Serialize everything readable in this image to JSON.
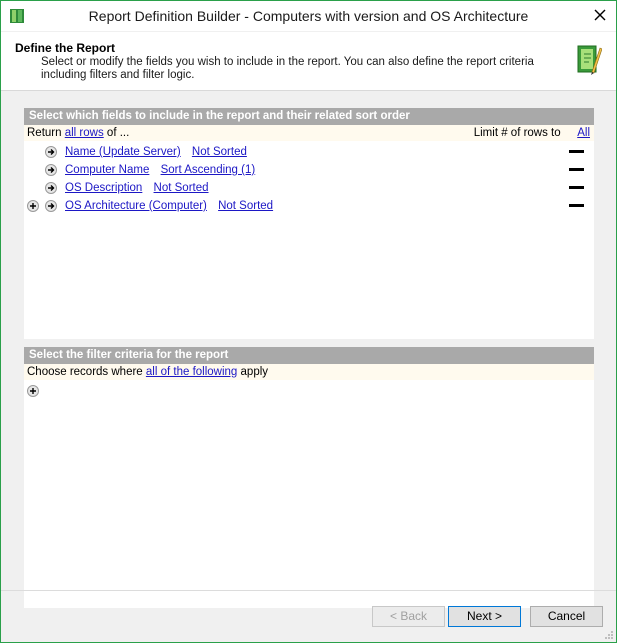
{
  "window": {
    "title": "Report Definition Builder - Computers with version and OS Architecture"
  },
  "header": {
    "title": "Define the Report",
    "description": "Select or modify the fields you wish to include in the report. You can also define the report criteria including filters and filter logic."
  },
  "fields_section": {
    "header": "Select which fields to include in the report and their related sort order",
    "return_prefix": "Return",
    "return_link": "all rows",
    "return_suffix": "of ...",
    "limit_label": "Limit # of rows to",
    "limit_link": "All",
    "rows": [
      {
        "field": "Name (Update Server)",
        "sort": "Not Sorted"
      },
      {
        "field": "Computer Name",
        "sort": "Sort Ascending (1)"
      },
      {
        "field": "OS Description",
        "sort": "Not Sorted"
      },
      {
        "field": "OS Architecture (Computer)",
        "sort": "Not Sorted"
      }
    ]
  },
  "filter_section": {
    "header": "Select the filter criteria for the report",
    "choose_prefix": "Choose records where",
    "choose_link": "all of the following",
    "choose_suffix": "apply"
  },
  "buttons": {
    "back": "< Back",
    "next": "Next >",
    "cancel": "Cancel"
  },
  "colors": {
    "window_border": "#2aa04a",
    "link": "#1c17c5",
    "section_header": "#a9a9a9",
    "sub_bar": "#fffaee"
  },
  "icons": {
    "app": "report-book-icon",
    "header": "report-pencil-icon",
    "add": "plus-circle-icon",
    "move": "arrow-right-circle-icon",
    "remove": "minus-bar-icon",
    "close": "close-icon"
  }
}
